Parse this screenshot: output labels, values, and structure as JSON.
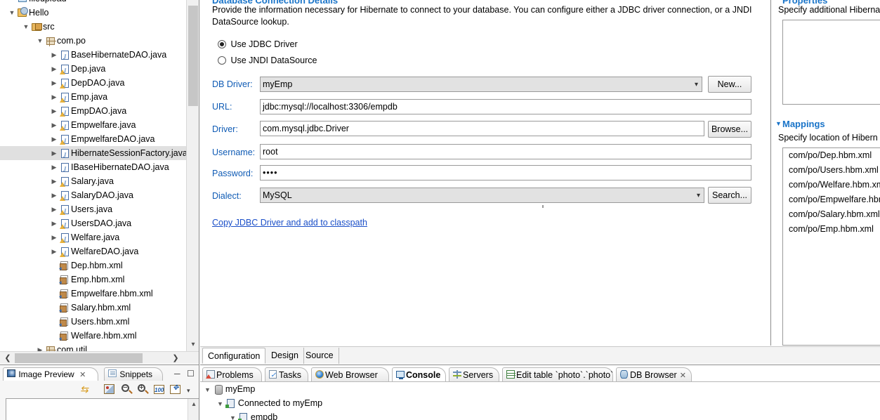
{
  "explorer": {
    "name": "package-explorer",
    "items": [
      {
        "label": "fileupload",
        "indent": 0,
        "twisty": "",
        "icon": "file",
        "selected": false,
        "clipped": true
      },
      {
        "label": "Hello",
        "indent": 0,
        "twisty": "v",
        "icon": "proj",
        "selected": false
      },
      {
        "label": "src",
        "indent": 1,
        "twisty": "v",
        "icon": "src",
        "selected": false
      },
      {
        "label": "com.po",
        "indent": 2,
        "twisty": "v",
        "icon": "pkg",
        "selected": false
      },
      {
        "label": "BaseHibernateDAO.java",
        "indent": 3,
        "twisty": ">",
        "icon": "java",
        "selected": false
      },
      {
        "label": "Dep.java",
        "indent": 3,
        "twisty": ">",
        "icon": "java-warn",
        "selected": false
      },
      {
        "label": "DepDAO.java",
        "indent": 3,
        "twisty": ">",
        "icon": "java-warn",
        "selected": false
      },
      {
        "label": "Emp.java",
        "indent": 3,
        "twisty": ">",
        "icon": "java-warn",
        "selected": false
      },
      {
        "label": "EmpDAO.java",
        "indent": 3,
        "twisty": ">",
        "icon": "java-warn",
        "selected": false
      },
      {
        "label": "Empwelfare.java",
        "indent": 3,
        "twisty": ">",
        "icon": "java-warn",
        "selected": false
      },
      {
        "label": "EmpwelfareDAO.java",
        "indent": 3,
        "twisty": ">",
        "icon": "java-warn",
        "selected": false
      },
      {
        "label": "HibernateSessionFactory.java",
        "indent": 3,
        "twisty": ">",
        "icon": "java",
        "selected": true
      },
      {
        "label": "IBaseHibernateDAO.java",
        "indent": 3,
        "twisty": ">",
        "icon": "java",
        "selected": false
      },
      {
        "label": "Salary.java",
        "indent": 3,
        "twisty": ">",
        "icon": "java-warn",
        "selected": false
      },
      {
        "label": "SalaryDAO.java",
        "indent": 3,
        "twisty": ">",
        "icon": "java-warn",
        "selected": false
      },
      {
        "label": "Users.java",
        "indent": 3,
        "twisty": ">",
        "icon": "java-warn",
        "selected": false
      },
      {
        "label": "UsersDAO.java",
        "indent": 3,
        "twisty": ">",
        "icon": "java-warn",
        "selected": false
      },
      {
        "label": "Welfare.java",
        "indent": 3,
        "twisty": ">",
        "icon": "java-warn",
        "selected": false
      },
      {
        "label": "WelfareDAO.java",
        "indent": 3,
        "twisty": ">",
        "icon": "java-warn",
        "selected": false
      },
      {
        "label": "Dep.hbm.xml",
        "indent": 3,
        "twisty": "",
        "icon": "xml",
        "selected": false
      },
      {
        "label": "Emp.hbm.xml",
        "indent": 3,
        "twisty": "",
        "icon": "xml",
        "selected": false
      },
      {
        "label": "Empwelfare.hbm.xml",
        "indent": 3,
        "twisty": "",
        "icon": "xml",
        "selected": false
      },
      {
        "label": "Salary.hbm.xml",
        "indent": 3,
        "twisty": "",
        "icon": "xml",
        "selected": false
      },
      {
        "label": "Users.hbm.xml",
        "indent": 3,
        "twisty": "",
        "icon": "xml",
        "selected": false
      },
      {
        "label": "Welfare.hbm.xml",
        "indent": 3,
        "twisty": "",
        "icon": "xml",
        "selected": false
      },
      {
        "label": "com.util",
        "indent": 2,
        "twisty": ">",
        "icon": "pkg",
        "selected": false
      }
    ]
  },
  "image_preview": {
    "tabs": [
      {
        "label": "Image Preview",
        "icon": "image-preview-icon",
        "active": true,
        "closable": true
      },
      {
        "label": "Snippets",
        "icon": "snippets-icon",
        "active": false,
        "closable": false
      }
    ],
    "toolbar": [
      {
        "name": "refresh-icon",
        "title": "Refresh"
      },
      {
        "name": "toggle-transparency-icon",
        "title": "Transparency"
      },
      {
        "name": "zoom-out-icon",
        "title": "Zoom Out"
      },
      {
        "name": "zoom-in-icon",
        "title": "Zoom In"
      },
      {
        "name": "zoom-100-icon",
        "title": "100%",
        "label": "100"
      },
      {
        "name": "zoom-fit-icon",
        "title": "Fit"
      },
      {
        "name": "view-menu-icon",
        "title": "View Menu"
      }
    ],
    "minimize_label": "Minimize",
    "maximize_label": "Maximize"
  },
  "editor": {
    "section": {
      "title": "Database Connection Details",
      "description": "Provide the information necessary for Hibernate to connect to your database.  You can configure either a JDBC driver connection, or a JNDI DataSource lookup."
    },
    "radios": [
      {
        "label": "Use JDBC Driver",
        "checked": true
      },
      {
        "label": "Use JNDI DataSource",
        "checked": false
      }
    ],
    "fields": [
      {
        "key": "db_driver",
        "label": "DB Driver:",
        "value": "myEmp",
        "type": "combo",
        "button": "New..."
      },
      {
        "key": "url",
        "label": "URL:",
        "value": "jdbc:mysql://localhost:3306/empdb",
        "type": "text",
        "button": ""
      },
      {
        "key": "driver",
        "label": "Driver:",
        "value": "com.mysql.jdbc.Driver",
        "type": "text",
        "button": "Browse..."
      },
      {
        "key": "username",
        "label": "Username:",
        "value": "root",
        "type": "text",
        "button": ""
      },
      {
        "key": "password",
        "label": "Password:",
        "value": "••••",
        "type": "text",
        "button": ""
      },
      {
        "key": "dialect",
        "label": "Dialect:",
        "value": "MySQL",
        "type": "combo",
        "button": "Search..."
      }
    ],
    "link": "Copy JDBC Driver and add to classpath",
    "tabs": [
      {
        "label": "Configuration",
        "active": true
      },
      {
        "label": "Design",
        "active": false
      },
      {
        "label": "Source",
        "active": false
      }
    ]
  },
  "properties_panel": {
    "title": "Properties",
    "description": "Specify additional Hibernate",
    "items": []
  },
  "mappings_panel": {
    "title": "Mappings",
    "description": "Specify location of Hibern",
    "items": [
      "com/po/Dep.hbm.xml",
      "com/po/Users.hbm.xml",
      "com/po/Welfare.hbm.xml",
      "com/po/Empwelfare.hbm.xml",
      "com/po/Salary.hbm.xml",
      "com/po/Emp.hbm.xml"
    ]
  },
  "bottom_views": {
    "tabs": [
      {
        "label": "Problems",
        "icon": "problems-icon",
        "active": false,
        "closable": false
      },
      {
        "label": "Tasks",
        "icon": "tasks-icon",
        "active": false,
        "closable": false
      },
      {
        "label": "Web Browser",
        "icon": "web-browser-icon",
        "active": false,
        "closable": false
      },
      {
        "label": "Console",
        "icon": "console-icon",
        "active": true,
        "closable": false
      },
      {
        "label": "Servers",
        "icon": "servers-icon",
        "active": false,
        "closable": false
      },
      {
        "label": "Edit table `photo`.`photo`",
        "icon": "edit-table-icon",
        "active": false,
        "closable": false
      },
      {
        "label": "DB Browser",
        "icon": "db-browser-icon",
        "active": false,
        "closable": true
      }
    ],
    "tree": [
      {
        "label": "myEmp",
        "indent": 0,
        "twisty": "v",
        "icon": "db-node"
      },
      {
        "label": "Connected to myEmp",
        "indent": 1,
        "twisty": "v",
        "icon": "connection-node"
      },
      {
        "label": "empdb",
        "indent": 2,
        "twisty": "v",
        "icon": "schema-node",
        "clipped": true
      }
    ]
  },
  "colors": {
    "link": "#1b4fc8",
    "section_title": "#1873c8",
    "field_label": "#0f5bb5",
    "selection": "#e0e0e0"
  }
}
